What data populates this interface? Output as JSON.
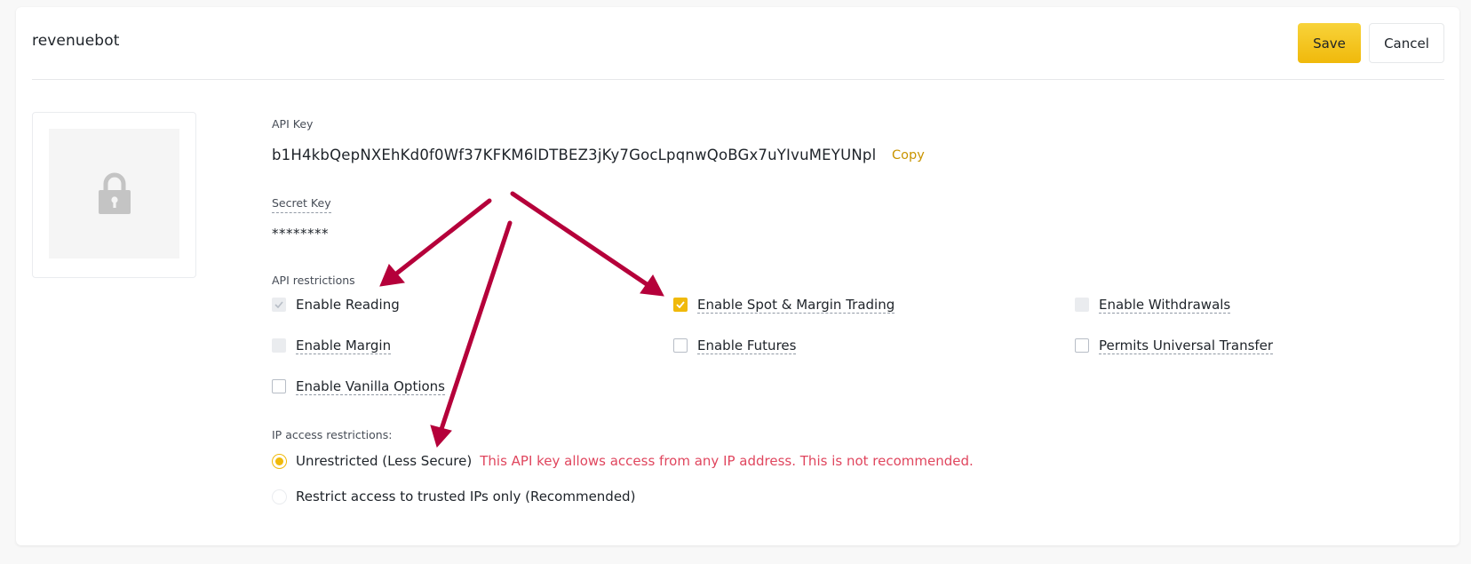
{
  "header": {
    "title": "revenuebot",
    "save_label": "Save",
    "cancel_label": "Cancel"
  },
  "avatar": {
    "icon": "lock-icon"
  },
  "api_key": {
    "label": "API Key",
    "value": "b1H4kbQepNXEhKd0f0Wf37KFKM6lDTBEZ3jKy7GocLpqnwQoBGx7uYIvuMEYUNpl",
    "copy_label": "Copy"
  },
  "secret_key": {
    "label": "Secret Key",
    "value": "********"
  },
  "api_restrictions": {
    "label": "API restrictions",
    "options": [
      {
        "label": "Enable Reading",
        "state": "checked-disabled"
      },
      {
        "label": "Enable Spot & Margin Trading",
        "state": "checked"
      },
      {
        "label": "Enable Withdrawals",
        "state": "disabled"
      },
      {
        "label": "Enable Margin",
        "state": "disabled"
      },
      {
        "label": "Enable Futures",
        "state": "unchecked"
      },
      {
        "label": "Permits Universal Transfer",
        "state": "unchecked"
      },
      {
        "label": "Enable Vanilla Options",
        "state": "unchecked"
      }
    ]
  },
  "ip_restrictions": {
    "label": "IP access restrictions:",
    "options": [
      {
        "label": "Unrestricted (Less Secure)",
        "selected": true
      },
      {
        "label": "Restrict access to trusted IPs only (Recommended)",
        "selected": false
      }
    ],
    "warning": "This API key allows access from any IP address. This is not recommended."
  },
  "colors": {
    "accent": "#f0b90b",
    "link": "#c99400",
    "warning": "#e0465e",
    "annotation_arrow": "#b5003a"
  }
}
